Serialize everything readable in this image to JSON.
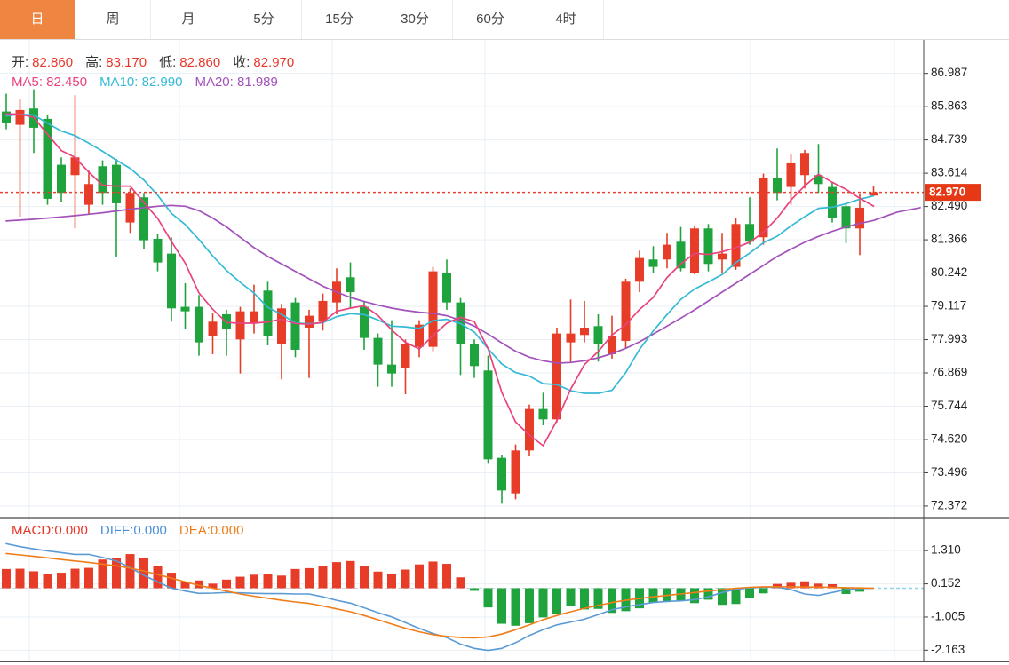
{
  "toolbar": {
    "tabs": [
      {
        "id": "day",
        "label": "日",
        "active": true
      },
      {
        "id": "week",
        "label": "周",
        "active": false
      },
      {
        "id": "month",
        "label": "月",
        "active": false
      },
      {
        "id": "5min",
        "label": "5分",
        "active": false
      },
      {
        "id": "15min",
        "label": "15分",
        "active": false
      },
      {
        "id": "30min",
        "label": "30分",
        "active": false
      },
      {
        "id": "60min",
        "label": "60分",
        "active": false
      },
      {
        "id": "4hour",
        "label": "4时",
        "active": false
      }
    ]
  },
  "ohlc_legend": {
    "open_label": "开:",
    "open": "82.860",
    "high_label": "高:",
    "high": "83.170",
    "low_label": "低:",
    "low": "82.860",
    "close_label": "收:",
    "close": "82.970"
  },
  "ma_legend": {
    "ma5": "MA5: 82.450",
    "ma10": "MA10: 82.990",
    "ma20": "MA20: 81.989"
  },
  "macd_legend": {
    "macd": "MACD:0.000",
    "diff": "DIFF:0.000",
    "dea": "DEA:0.000"
  },
  "price_tag": "82.970",
  "colors": {
    "up": "#e73c27",
    "down": "#1fa33c",
    "ma5": "#e8437f",
    "ma10": "#35b9d6",
    "ma20": "#a351bb",
    "diff": "#5b9bd5",
    "dea": "#ef7d1a",
    "price_line": "#e84030",
    "price_tag_bg": "#e53915",
    "grid": "#e9eff5",
    "vgrid": "#eaeff4",
    "axis": "#444",
    "tick_text": "#222",
    "panel_border": "#1a1a1a",
    "active_tab": "#ee8540",
    "macd_baseline": "#c8d7e2",
    "diff_dash_ext": "#8ed4e8"
  },
  "chart_data": {
    "type": "candlestick",
    "title": "",
    "y_axis_ticks": [
      "86.987",
      "85.863",
      "84.739",
      "83.614",
      "82.490",
      "81.366",
      "80.242",
      "79.117",
      "77.993",
      "76.869",
      "75.744",
      "74.620",
      "73.496",
      "72.372"
    ],
    "macd_axis_ticks": [
      "1.310",
      "0.152",
      "-1.005",
      "-2.163"
    ],
    "price_line_value": 82.97,
    "last_close": 82.97,
    "candles_format": "[open, high, low, close] red=up green=down",
    "candles": [
      [
        85.7,
        86.3,
        85.1,
        85.3
      ],
      [
        85.25,
        86.1,
        82.15,
        85.75
      ],
      [
        85.8,
        86.45,
        84.3,
        85.15
      ],
      [
        85.45,
        85.6,
        82.55,
        82.75
      ],
      [
        83.9,
        84.15,
        82.65,
        82.95
      ],
      [
        83.55,
        86.25,
        81.75,
        84.15
      ],
      [
        82.55,
        83.7,
        82.25,
        83.25
      ],
      [
        83.85,
        84.05,
        82.55,
        82.95
      ],
      [
        83.9,
        84.1,
        80.8,
        82.6
      ],
      [
        81.95,
        83.1,
        81.6,
        82.95
      ],
      [
        82.8,
        82.95,
        81.05,
        81.35
      ],
      [
        81.4,
        81.55,
        80.3,
        80.6
      ],
      [
        80.9,
        81.45,
        78.6,
        79.05
      ],
      [
        79.1,
        79.9,
        78.35,
        78.95
      ],
      [
        79.1,
        79.5,
        77.45,
        77.9
      ],
      [
        78.1,
        78.9,
        77.5,
        78.6
      ],
      [
        78.85,
        79.0,
        77.45,
        78.35
      ],
      [
        78.0,
        79.1,
        76.85,
        78.95
      ],
      [
        78.55,
        79.85,
        78.2,
        78.95
      ],
      [
        79.65,
        79.95,
        77.8,
        78.1
      ],
      [
        77.85,
        79.2,
        76.65,
        79.05
      ],
      [
        79.25,
        79.4,
        77.4,
        77.65
      ],
      [
        78.4,
        79.0,
        76.7,
        78.8
      ],
      [
        78.6,
        79.55,
        78.3,
        79.3
      ],
      [
        79.25,
        80.4,
        78.85,
        79.95
      ],
      [
        80.1,
        80.6,
        79.05,
        79.6
      ],
      [
        79.1,
        79.3,
        77.65,
        78.05
      ],
      [
        78.05,
        78.2,
        76.4,
        77.15
      ],
      [
        77.15,
        78.65,
        76.4,
        76.85
      ],
      [
        77.05,
        78.0,
        76.15,
        77.85
      ],
      [
        77.75,
        78.65,
        77.4,
        78.5
      ],
      [
        77.75,
        80.45,
        77.6,
        80.3
      ],
      [
        80.25,
        80.7,
        79.0,
        79.25
      ],
      [
        79.25,
        79.4,
        76.8,
        77.85
      ],
      [
        77.85,
        78.0,
        76.7,
        77.1
      ],
      [
        76.95,
        77.45,
        73.8,
        73.95
      ],
      [
        74.0,
        74.1,
        72.45,
        72.9
      ],
      [
        72.8,
        74.45,
        72.6,
        74.25
      ],
      [
        74.25,
        75.8,
        74.05,
        75.65
      ],
      [
        75.65,
        76.2,
        75.1,
        75.3
      ],
      [
        75.3,
        78.4,
        75.2,
        78.2
      ],
      [
        77.9,
        79.35,
        77.2,
        78.2
      ],
      [
        78.15,
        79.3,
        77.9,
        78.4
      ],
      [
        78.45,
        78.85,
        77.25,
        77.85
      ],
      [
        77.5,
        78.8,
        77.35,
        78.1
      ],
      [
        77.95,
        80.05,
        77.7,
        79.95
      ],
      [
        79.95,
        81.0,
        79.6,
        80.75
      ],
      [
        80.7,
        81.15,
        80.25,
        80.45
      ],
      [
        80.7,
        81.6,
        80.4,
        81.2
      ],
      [
        81.3,
        81.8,
        80.3,
        80.4
      ],
      [
        80.25,
        81.85,
        80.2,
        81.75
      ],
      [
        81.75,
        81.9,
        80.3,
        80.55
      ],
      [
        80.7,
        81.6,
        80.25,
        80.9
      ],
      [
        80.45,
        82.1,
        80.35,
        81.9
      ],
      [
        81.9,
        82.8,
        81.2,
        81.3
      ],
      [
        81.45,
        83.6,
        81.2,
        83.45
      ],
      [
        83.45,
        84.45,
        82.7,
        82.95
      ],
      [
        83.15,
        84.25,
        82.55,
        83.95
      ],
      [
        83.55,
        84.4,
        83.1,
        84.3
      ],
      [
        83.55,
        84.6,
        82.95,
        83.25
      ],
      [
        83.15,
        83.3,
        81.95,
        82.1
      ],
      [
        82.5,
        82.6,
        81.25,
        81.75
      ],
      [
        81.75,
        82.9,
        80.85,
        82.45
      ],
      [
        82.86,
        83.17,
        82.86,
        82.97
      ]
    ],
    "pre_closes_for_ma": [
      85.2,
      85.4,
      85.5,
      85.6,
      85.7,
      85.8,
      85.7,
      85.6,
      85.7
    ],
    "ma20_values": [
      82.0,
      82.03,
      82.06,
      82.1,
      82.14,
      82.18,
      82.23,
      82.28,
      82.34,
      82.4,
      82.45,
      82.5,
      82.53,
      82.5,
      82.35,
      82.1,
      81.8,
      81.45,
      81.1,
      80.8,
      80.55,
      80.3,
      80.05,
      79.8,
      79.6,
      79.42,
      79.28,
      79.16,
      79.06,
      78.98,
      78.92,
      78.88,
      78.8,
      78.65,
      78.45,
      78.18,
      77.88,
      77.6,
      77.4,
      77.28,
      77.2,
      77.22,
      77.28,
      77.38,
      77.52,
      77.7,
      77.92,
      78.18,
      78.45,
      78.72,
      79.0,
      79.3,
      79.6,
      79.9,
      80.2,
      80.5,
      80.8,
      81.05,
      81.28,
      81.48,
      81.65,
      81.8,
      81.92,
      82.02
    ],
    "ma20_extension": [
      [
        1010,
        82.3
      ],
      [
        1036,
        82.45
      ]
    ],
    "macd_hist": [
      0.67,
      0.68,
      0.59,
      0.5,
      0.54,
      0.68,
      0.71,
      1.0,
      1.04,
      1.19,
      1.04,
      0.78,
      0.54,
      0.22,
      0.27,
      0.16,
      0.3,
      0.4,
      0.47,
      0.49,
      0.44,
      0.67,
      0.7,
      0.78,
      0.91,
      0.95,
      0.78,
      0.58,
      0.51,
      0.65,
      0.83,
      0.93,
      0.85,
      0.38,
      -0.09,
      -0.67,
      -1.24,
      -1.31,
      -1.22,
      -1.02,
      -0.91,
      -0.62,
      -0.74,
      -0.72,
      -0.86,
      -0.8,
      -0.7,
      -0.5,
      -0.45,
      -0.45,
      -0.52,
      -0.4,
      -0.58,
      -0.55,
      -0.34,
      -0.18,
      0.15,
      0.19,
      0.24,
      0.16,
      0.14,
      -0.2,
      -0.12,
      0.0
    ],
    "diff_line": [
      1.55,
      1.45,
      1.37,
      1.3,
      1.24,
      1.18,
      1.18,
      1.07,
      0.95,
      0.72,
      0.45,
      0.22,
      0.0,
      -0.1,
      -0.18,
      -0.17,
      -0.15,
      -0.16,
      -0.18,
      -0.19,
      -0.19,
      -0.2,
      -0.2,
      -0.3,
      -0.42,
      -0.52,
      -0.68,
      -0.85,
      -1.0,
      -1.2,
      -1.4,
      -1.58,
      -1.72,
      -1.95,
      -2.1,
      -2.17,
      -2.1,
      -1.9,
      -1.65,
      -1.45,
      -1.28,
      -1.18,
      -1.08,
      -0.92,
      -0.75,
      -0.65,
      -0.57,
      -0.5,
      -0.46,
      -0.44,
      -0.4,
      -0.3,
      -0.15,
      -0.04,
      0.02,
      0.03,
      0.04,
      -0.05,
      -0.2,
      -0.25,
      -0.15,
      -0.05,
      -0.01,
      0.0
    ],
    "dea_line": [
      1.21,
      1.16,
      1.11,
      1.06,
      1.0,
      0.95,
      0.9,
      0.84,
      0.78,
      0.7,
      0.6,
      0.48,
      0.35,
      0.22,
      0.1,
      0.0,
      -0.1,
      -0.2,
      -0.28,
      -0.35,
      -0.42,
      -0.48,
      -0.53,
      -0.62,
      -0.72,
      -0.82,
      -0.95,
      -1.1,
      -1.25,
      -1.4,
      -1.52,
      -1.62,
      -1.68,
      -1.72,
      -1.73,
      -1.7,
      -1.6,
      -1.45,
      -1.28,
      -1.1,
      -0.95,
      -0.82,
      -0.7,
      -0.6,
      -0.5,
      -0.42,
      -0.36,
      -0.3,
      -0.25,
      -0.2,
      -0.15,
      -0.1,
      -0.05,
      0.0,
      0.03,
      0.05,
      0.05,
      0.05,
      0.04,
      0.04,
      0.03,
      0.02,
      0.01,
      0.0
    ]
  }
}
